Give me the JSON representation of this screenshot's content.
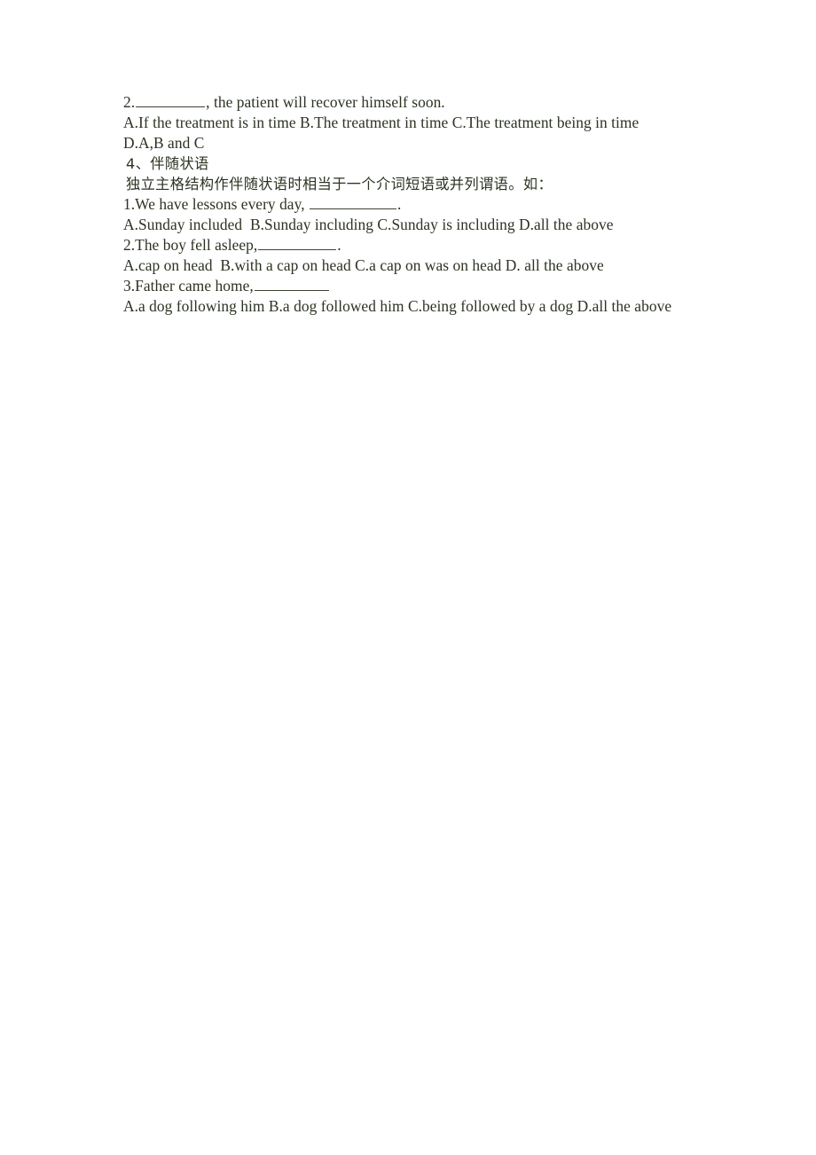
{
  "document": {
    "background_color": "#ffffff",
    "text_color": "#2b3322",
    "lines": {
      "q2_stem_prefix": "2.",
      "q2_stem_suffix": ", the patient will recover himself soon.",
      "q2_options_ac": "A.If the treatment is in time B.The treatment in time C.The treatment being in time",
      "q2_option_d": "D.A,B and C",
      "section_heading": "4、伴随状语",
      "section_note": "独立主格结构作伴随状语时相当于一个介词短语或并列谓语。如：",
      "s1_stem_prefix": "1.We have lessons every day, ",
      "s1_stem_suffix": ".",
      "s1_options": "A.Sunday included  B.Sunday including C.Sunday is including D.all the above",
      "s2_stem_prefix": "2.The boy fell asleep,",
      "s2_stem_suffix": ".",
      "s2_options": "A.cap on head  B.with a cap on head C.a cap on was on head D. all the above",
      "s3_stem_prefix": "3.Father came home,",
      "s3_options": "A.a dog following him  B.a dog followed him C.being followed by a dog D.all the above"
    }
  }
}
